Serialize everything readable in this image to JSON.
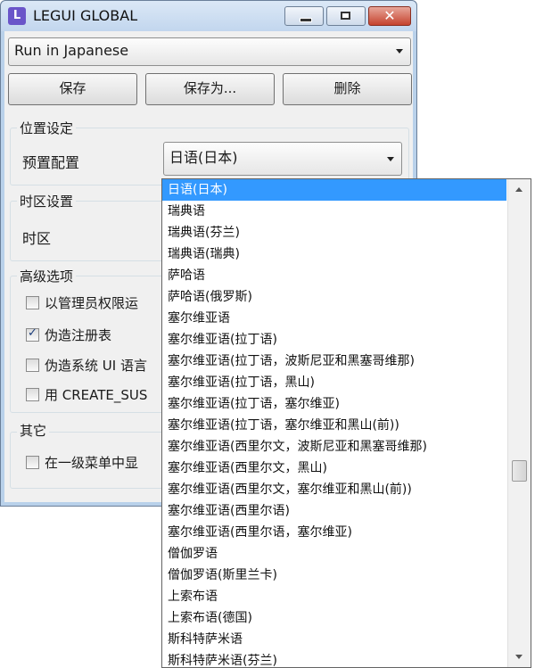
{
  "window": {
    "icon_letter": "L",
    "title": "LEGUI GLOBAL",
    "close_glyph": "✕"
  },
  "profile_select": {
    "value": "Run in Japanese"
  },
  "toolbar": {
    "save_label": "保存",
    "save_as_label": "保存为...",
    "delete_label": "删除"
  },
  "location_group": {
    "title": "位置设定",
    "preset_label": "预置配置",
    "preset_value": "日语(日本)"
  },
  "timezone_group": {
    "title": "时区设置",
    "timezone_label": "时区"
  },
  "advanced_group": {
    "title": "高级选项",
    "options": [
      {
        "label": "以管理员权限运",
        "checked": false
      },
      {
        "label": "伪造注册表",
        "checked": true
      },
      {
        "label": "伪造系统 UI 语言",
        "checked": false
      },
      {
        "label": "用 CREATE_SUS",
        "checked": false
      }
    ]
  },
  "other_group": {
    "title": "其它",
    "options": [
      {
        "label": "在一级菜单中显",
        "checked": false
      }
    ]
  },
  "dropdown": {
    "selected_index": 0,
    "items": [
      "日语(日本)",
      "瑞典语",
      "瑞典语(芬兰)",
      "瑞典语(瑞典)",
      "萨哈语",
      "萨哈语(俄罗斯)",
      "塞尔维亚语",
      "塞尔维亚语(拉丁语)",
      "塞尔维亚语(拉丁语，波斯尼亚和黑塞哥维那)",
      "塞尔维亚语(拉丁语，黑山)",
      "塞尔维亚语(拉丁语，塞尔维亚)",
      "塞尔维亚语(拉丁语，塞尔维亚和黑山(前))",
      "塞尔维亚语(西里尔文，波斯尼亚和黑塞哥维那)",
      "塞尔维亚语(西里尔文，黑山)",
      "塞尔维亚语(西里尔文，塞尔维亚和黑山(前))",
      "塞尔维亚语(西里尔语)",
      "塞尔维亚语(西里尔语，塞尔维亚)",
      "僧伽罗语",
      "僧伽罗语(斯里兰卡)",
      "上索布语",
      "上索布语(德国)",
      "斯科特萨米语",
      "斯科特萨米语(芬兰)"
    ]
  }
}
